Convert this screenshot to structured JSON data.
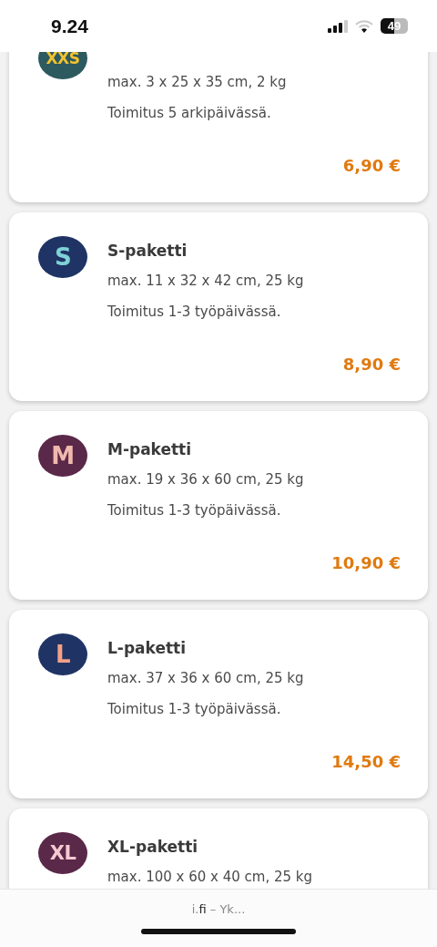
{
  "status_bar": {
    "time": "9.24",
    "battery": "49"
  },
  "parcels": [
    {
      "color": "#2d5a5f",
      "badge": {
        "text": "XXS",
        "color": "#f2c230"
      },
      "size": "max. 3 x 25 x 35 cm, 2 kg",
      "delivery": "Toimitus 5 arkipäivässä.",
      "price": "6,90 €"
    },
    {
      "color": "#1f3464",
      "badge": {
        "text": "S",
        "color": "#7fd2d6"
      },
      "name": "S-paketti",
      "size": "max. 11 x 32 x 42 cm, 25 kg",
      "delivery": "Toimitus 1-3 työpäivässä.",
      "price": "8,90 €"
    },
    {
      "color": "#5a2848",
      "badge": {
        "text": "M",
        "color": "#f0b9ae"
      },
      "name": "M-paketti",
      "size": "max. 19 x 36 x 60 cm, 25 kg",
      "delivery": "Toimitus 1-3 työpäivässä.",
      "price": "10,90 €"
    },
    {
      "color": "#1f3464",
      "badge": {
        "text": "L",
        "color": "#f4a087"
      },
      "name": "L-paketti",
      "size": "max. 37 x 36 x 60 cm, 25 kg",
      "delivery": "Toimitus 1-3 työpäivässä.",
      "price": "14,50 €"
    },
    {
      "color": "#5a2848",
      "badge": {
        "text": "XL",
        "color": "#f5c9d2"
      },
      "name": "XL-paketti",
      "size": "max. 100 x 60 x 40 cm, 25 kg"
    }
  ],
  "address_bar": {
    "url": "i.**fi** – Yk..."
  }
}
